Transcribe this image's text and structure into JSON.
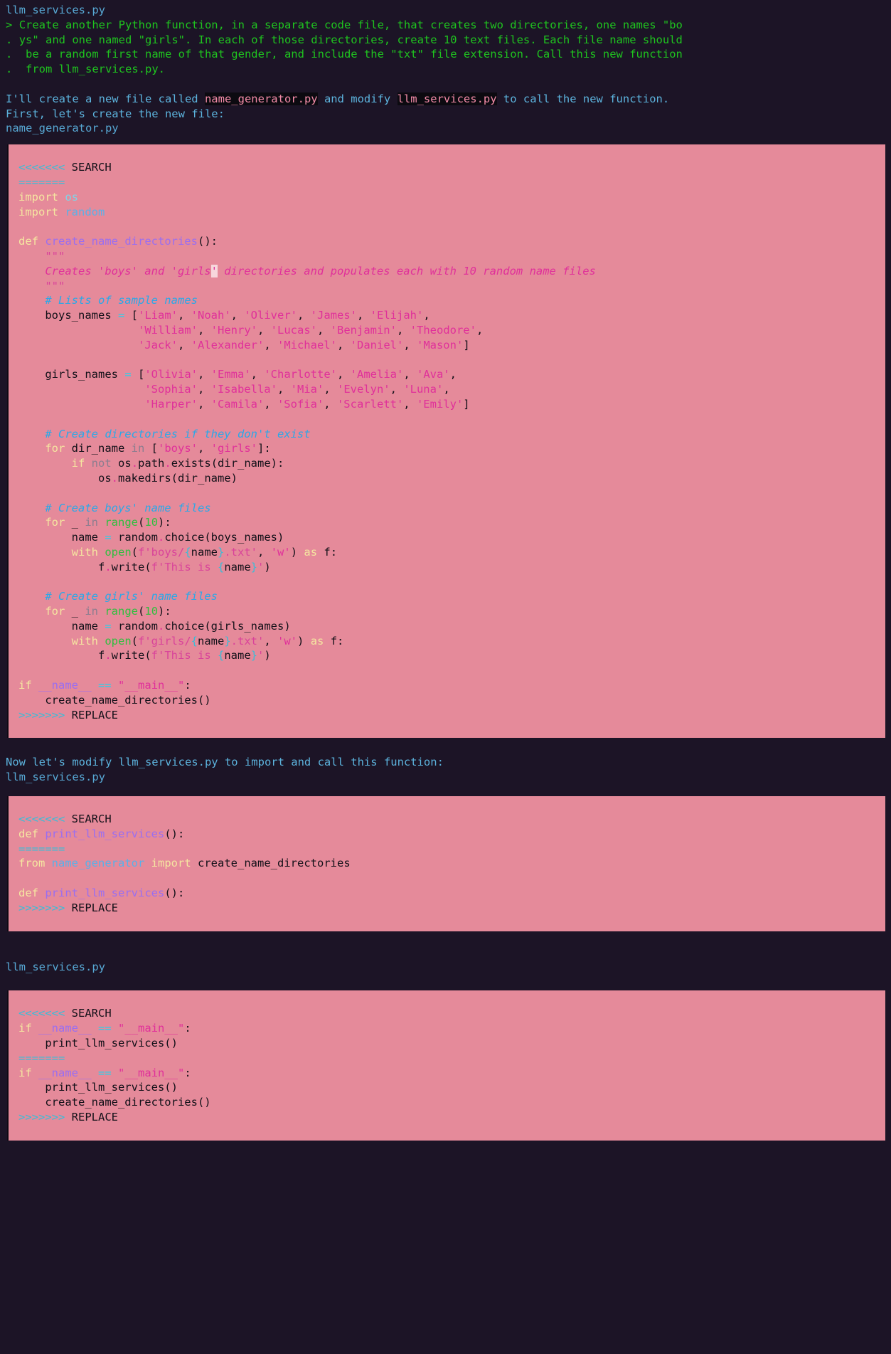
{
  "meta": {
    "app": "aider-terminal-session",
    "bg_color": "#1c1426",
    "code_block_bg": "#e58a9a",
    "user_text_color": "#1fc41f",
    "assistant_text_color": "#5cb3dd",
    "filename_color": "#57a8d4"
  },
  "header": {
    "filename": "llm_services.py",
    "prompt_marker": ">",
    "continuation_marker": ".",
    "user_request_lines": [
      "Create another Python function, in a separate code file, that creates two directories, one names \"bo",
      "ys\" and one named \"girls\". In each of those directories, create 10 text files. Each file name should",
      "be a random first name of that gender, and include the \"txt\" file extension. Call this new function",
      "from llm_services.py."
    ]
  },
  "assistant_intro": {
    "part1": "I'll create a new file called ",
    "highlight1": "name_generator.py",
    "part2": " and modify ",
    "highlight2": "llm_services.py",
    "part3": " to call the new function.",
    "line2": "First, let's create the new file:",
    "file_label": "name_generator.py"
  },
  "code_block_1": {
    "file": "name_generator.py",
    "search_marker": "<<<<<<<",
    "search_label": "SEARCH",
    "divider": "=======",
    "replace_marker": ">>>>>>>",
    "replace_label": "REPLACE",
    "lines": [
      "import os",
      "import random",
      "",
      "def create_name_directories():",
      "    \"\"\"",
      "    Creates 'boys' and 'girls' directories and populates each with 10 random name files",
      "    \"\"\"",
      "    # Lists of sample names",
      "    boys_names = ['Liam', 'Noah', 'Oliver', 'James', 'Elijah',",
      "                  'William', 'Henry', 'Lucas', 'Benjamin', 'Theodore',",
      "                  'Jack', 'Alexander', 'Michael', 'Daniel', 'Mason']",
      "",
      "    girls_names = ['Olivia', 'Emma', 'Charlotte', 'Amelia', 'Ava',",
      "                   'Sophia', 'Isabella', 'Mia', 'Evelyn', 'Luna',",
      "                   'Harper', 'Camila', 'Sofia', 'Scarlett', 'Emily']",
      "",
      "    # Create directories if they don't exist",
      "    for dir_name in ['boys', 'girls']:",
      "        if not os.path.exists(dir_name):",
      "            os.makedirs(dir_name)",
      "",
      "    # Create boys' name files",
      "    for _ in range(10):",
      "        name = random.choice(boys_names)",
      "        with open(f'boys/{name}.txt', 'w') as f:",
      "            f.write(f'This is {name}')",
      "",
      "    # Create girls' name files",
      "    for _ in range(10):",
      "        name = random.choice(girls_names)",
      "        with open(f'girls/{name}.txt', 'w') as f:",
      "            f.write(f'This is {name}')",
      "",
      "if __name__ == \"__main__\":",
      "    create_name_directories()"
    ]
  },
  "assistant_mid": {
    "line1": "Now let's modify llm_services.py to import and call this function:",
    "file_label": "llm_services.py"
  },
  "code_block_2": {
    "file": "llm_services.py",
    "search_marker": "<<<<<<<",
    "search_label": "SEARCH",
    "divider": "=======",
    "replace_marker": ">>>>>>>",
    "replace_label": "REPLACE",
    "search_lines": [
      "def print_llm_services():"
    ],
    "replace_lines": [
      "from name_generator import create_name_directories",
      "",
      "def print_llm_services():"
    ]
  },
  "assistant_tail": {
    "file_label": "llm_services.py"
  },
  "code_block_3": {
    "file": "llm_services.py",
    "search_marker": "<<<<<<<",
    "search_label": "SEARCH",
    "divider": "=======",
    "replace_marker": ">>>>>>>",
    "replace_label": "REPLACE",
    "search_lines": [
      "if __name__ == \"__main__\":",
      "    print_llm_services()"
    ],
    "replace_lines": [
      "if __name__ == \"__main__\":",
      "    print_llm_services()",
      "    create_name_directories()"
    ]
  }
}
